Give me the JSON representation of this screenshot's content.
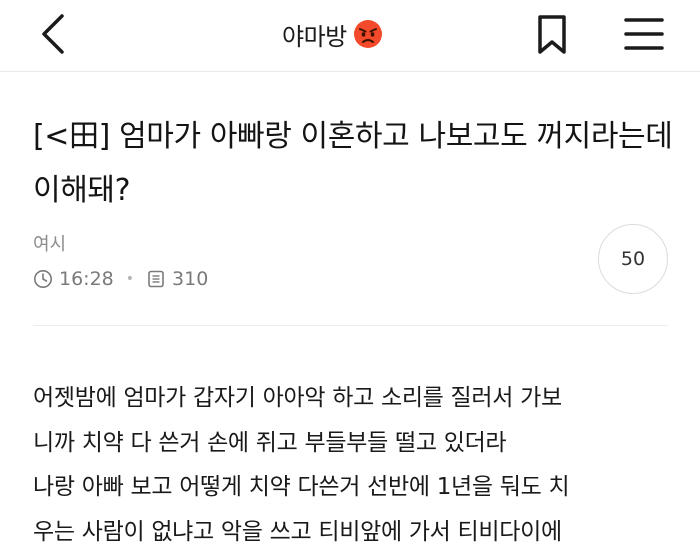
{
  "header": {
    "title": "야마방",
    "emoji": "angry-face-emoji"
  },
  "post": {
    "title": "[<田] 엄마가 아빠랑 이혼하고 나보고도 꺼지라는데 이해돼?",
    "author": "여시",
    "time": "16:28",
    "views": "310",
    "comments": "50"
  },
  "body": {
    "lines": [
      "어젯밤에 엄마가 갑자기 아아악 하고 소리를 질러서 가보",
      "니까 치약 다 쓴거 손에 쥐고 부들부들 떨고 있더라",
      "나랑 아빠 보고 어떻게 치약 다쓴거 선반에 1년을 둬도 치",
      "우는 사람이 없냐고 악을 쓰고 티비앞에 가서 티비다이에"
    ]
  },
  "icons": {
    "back": "chevron-left-icon",
    "bookmark": "bookmark-icon",
    "menu": "hamburger-menu-icon",
    "clock": "clock-icon",
    "views": "document-icon"
  },
  "colors": {
    "text": "#1b1b1b",
    "meta": "#8c8c8c",
    "divider": "#e9e9e9"
  }
}
